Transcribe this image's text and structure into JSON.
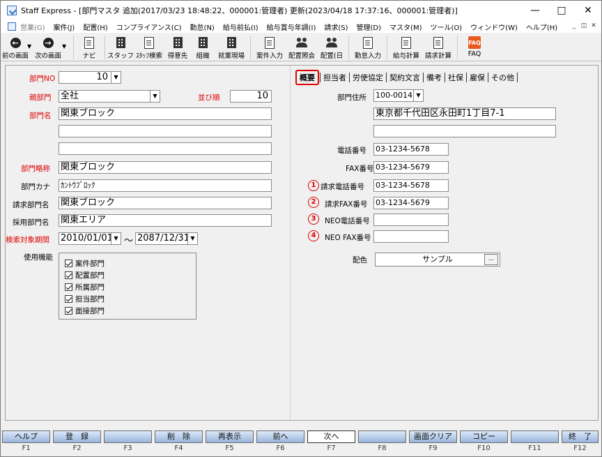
{
  "window": {
    "title": "Staff Express - [部門マスタ 追加(2017/03/23 18:48:22、000001:管理者) 更新(2023/04/18 17:37:16、000001:管理者)]"
  },
  "menu": [
    "営業(G)",
    "案件(J)",
    "配置(H)",
    "コンプライアンス(C)",
    "勤怠(N)",
    "給与前払(I)",
    "給与賞与年調(I)",
    "請求(S)",
    "管理(D)",
    "マスタ(M)",
    "ツール(O)",
    "ウィンドウ(W)",
    "ヘルプ(H)"
  ],
  "toolbar": [
    {
      "name": "prev-screen",
      "label": "前の画面",
      "icon": "arrow-left-icon"
    },
    {
      "name": "next-screen",
      "label": "次の画面",
      "icon": "arrow-right-icon"
    },
    {
      "name": "navi",
      "label": "ナビ",
      "icon": "navi-icon"
    },
    {
      "name": "staff",
      "label": "スタッフ",
      "icon": "staff-icon"
    },
    {
      "name": "staff-search",
      "label": "ｽﾀｯﾌ検索",
      "icon": "staff-search-icon"
    },
    {
      "name": "customer",
      "label": "得意先",
      "icon": "customer-icon"
    },
    {
      "name": "org",
      "label": "組織",
      "icon": "org-icon"
    },
    {
      "name": "worksite",
      "label": "就業現場",
      "icon": "worksite-icon"
    },
    {
      "name": "case-input",
      "label": "案件入力",
      "icon": "case-input-icon"
    },
    {
      "name": "assign-inquiry",
      "label": "配置照会",
      "icon": "assign-inquiry-icon"
    },
    {
      "name": "assign-day",
      "label": "配置(日",
      "icon": "assign-day-icon"
    },
    {
      "name": "attendance-input",
      "label": "勤怠入力",
      "icon": "attendance-input-icon"
    },
    {
      "name": "pay-calc",
      "label": "給与計算",
      "icon": "pay-calc-icon"
    },
    {
      "name": "bill-calc",
      "label": "請求計算",
      "icon": "bill-calc-icon"
    },
    {
      "name": "faq",
      "label": "FAQ",
      "icon": "faq-icon"
    }
  ],
  "left": {
    "dept_no_label": "部門NO",
    "dept_no": "10",
    "parent_label": "親部門",
    "parent": "全社",
    "order_label": "並び順",
    "order": "10",
    "name_label": "部門名",
    "name1": "関東ブロック",
    "name2": "",
    "name3": "",
    "short_label": "部門略称",
    "short": "関東ブロック",
    "kana_label": "部門カナ",
    "kana": "ｶﾝﾄｳﾌﾞﾛｯｸ",
    "bill_label": "請求部門名",
    "bill": "関東ブロック",
    "hire_label": "採用部門名",
    "hire": "関東エリア",
    "period_label": "検索対象期間",
    "period_from": "2010/01/01",
    "period_sep": "～",
    "period_to": "2087/12/31",
    "funcs_label": "使用機能",
    "funcs": [
      "案件部門",
      "配置部門",
      "所属部門",
      "担当部門",
      "面接部門"
    ]
  },
  "tabs": [
    "概要",
    "担当者",
    "労使協定",
    "契約文言",
    "備考",
    "社保",
    "雇保",
    "その他"
  ],
  "right": {
    "address_label": "部門住所",
    "zip": "100-0014",
    "addr1": "東京都千代田区永田町1丁目7-1",
    "addr2": "",
    "tel_label": "電話番号",
    "tel": "03-1234-5678",
    "fax_label": "FAX番号",
    "fax": "03-1234-5679",
    "btel_num": "1",
    "btel_label": "請求電話番号",
    "btel": "03-1234-5678",
    "bfax_num": "2",
    "bfax_label": "請求FAX番号",
    "bfax": "03-1234-5679",
    "neotel_num": "3",
    "neotel_label": "NEO電話番号",
    "neotel": "",
    "neofax_num": "4",
    "neofax_label": "NEO FAX番号",
    "neofax": "",
    "color_label": "配色",
    "color": "サンプル",
    "color_btn": "..."
  },
  "fkeys": [
    {
      "k": "F1",
      "l": "ヘルプ"
    },
    {
      "k": "F2",
      "l": "登　録"
    },
    {
      "k": "F3",
      "l": ""
    },
    {
      "k": "F4",
      "l": "削　除"
    },
    {
      "k": "F5",
      "l": "再表示"
    },
    {
      "k": "F6",
      "l": "前へ"
    },
    {
      "k": "F7",
      "l": "次へ"
    },
    {
      "k": "F8",
      "l": ""
    },
    {
      "k": "F9",
      "l": "画面クリア"
    },
    {
      "k": "F10",
      "l": "コピー"
    },
    {
      "k": "F11",
      "l": ""
    },
    {
      "k": "F12",
      "l": "終　了"
    }
  ]
}
